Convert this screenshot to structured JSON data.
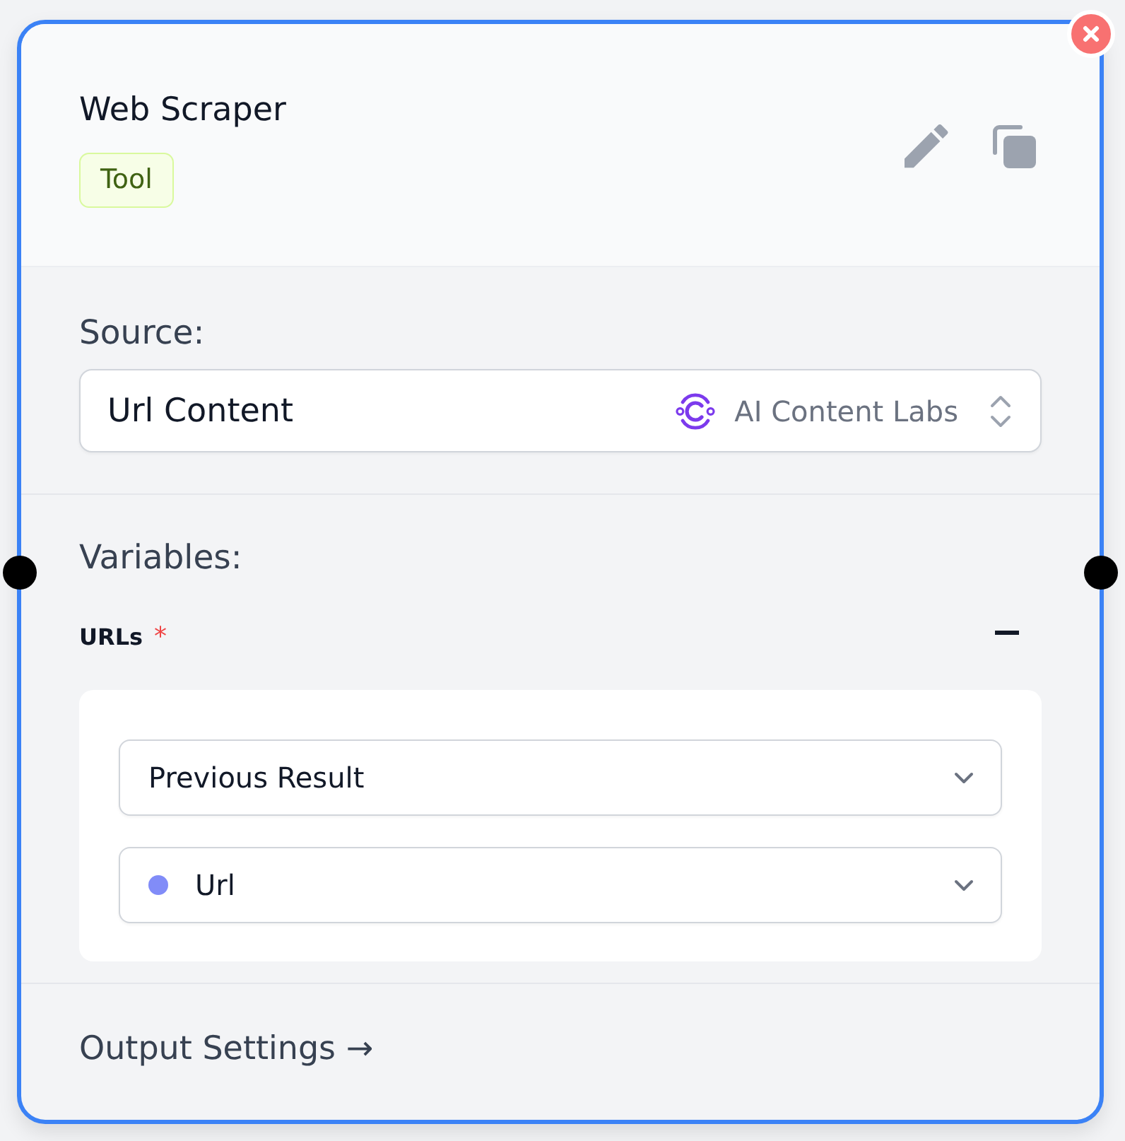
{
  "node": {
    "title": "Web Scraper",
    "tag": "Tool"
  },
  "source": {
    "label": "Source:",
    "value": "Url Content",
    "provider": "AI Content Labs"
  },
  "variables": {
    "label": "Variables:",
    "groups": [
      {
        "name": "URLs",
        "required_mark": "*",
        "expanded": true,
        "inputs": [
          {
            "kind": "select",
            "value": "Previous Result"
          },
          {
            "kind": "variable",
            "value": "Url",
            "color": "#818cf8"
          }
        ]
      }
    ]
  },
  "footer": {
    "link": "Output Settings →"
  }
}
